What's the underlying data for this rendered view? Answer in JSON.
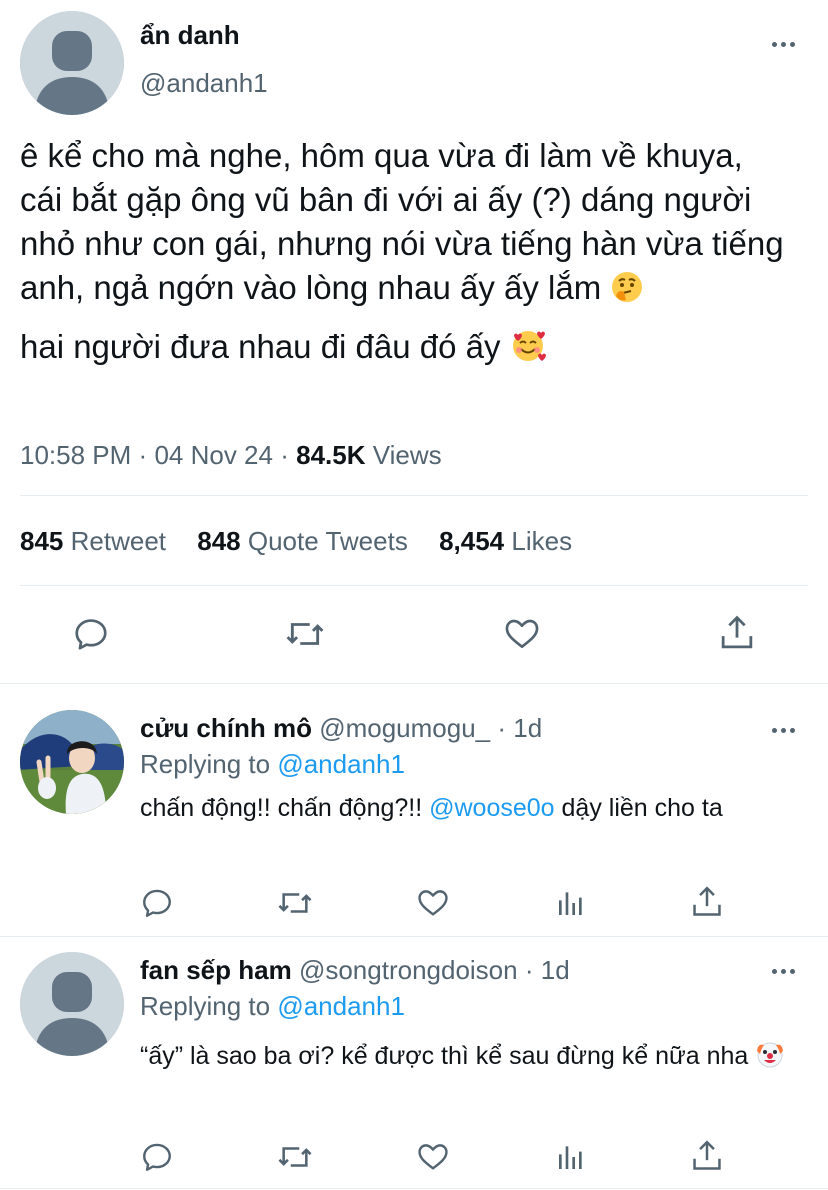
{
  "main_tweet": {
    "display_name": "ẩn danh",
    "handle": "@andanh1",
    "text_lines": [
      "ê kể cho mà nghe, hôm qua vừa đi làm về khuya, cái bắt gặp ông vũ bân đi với ai ấy (?) dáng người nhỏ như con gái, nhưng nói vừa tiếng hàn vừa tiếng anh, ngả ngớn vào lòng nhau ấy ấy lắm",
      "hai người đưa nhau đi đâu đó ấy"
    ],
    "emojis": [
      "thinking-face",
      "smiling-face-with-hearts"
    ],
    "time": "10:58 PM",
    "date": "04 Nov 24",
    "views_count": "84.5K",
    "views_label": "Views",
    "retweet_count": "845",
    "retweet_label": "Retweet",
    "quote_count": "848",
    "quote_label": "Quote Tweets",
    "likes_count": "8,454",
    "likes_label": "Likes"
  },
  "replies": [
    {
      "display_name": "cửu chính mô",
      "handle": "@mogumogu_",
      "age": "1d",
      "replying_label": "Replying to",
      "replying_to": "@andanh1",
      "text_before": "chấn động!! chấn động?!! ",
      "mention": "@woose0o",
      "text_after": " dậy liền cho ta"
    },
    {
      "display_name": "fan sếp ham",
      "handle": "@songtrongdoison",
      "age": "1d",
      "replying_label": "Replying to",
      "replying_to": "@andanh1",
      "text": "“ấy” là sao ba ơi? kể được thì kể sau đừng kể nữa nha",
      "emoji": "clown-face"
    }
  ],
  "separator": "·",
  "colors": {
    "text": "#0f1419",
    "secondary": "#536471",
    "link": "#1d9bf0",
    "divider": "#e6ecf0",
    "avatar_default": "#ccd6dd",
    "avatar_silhouette": "#657786"
  }
}
